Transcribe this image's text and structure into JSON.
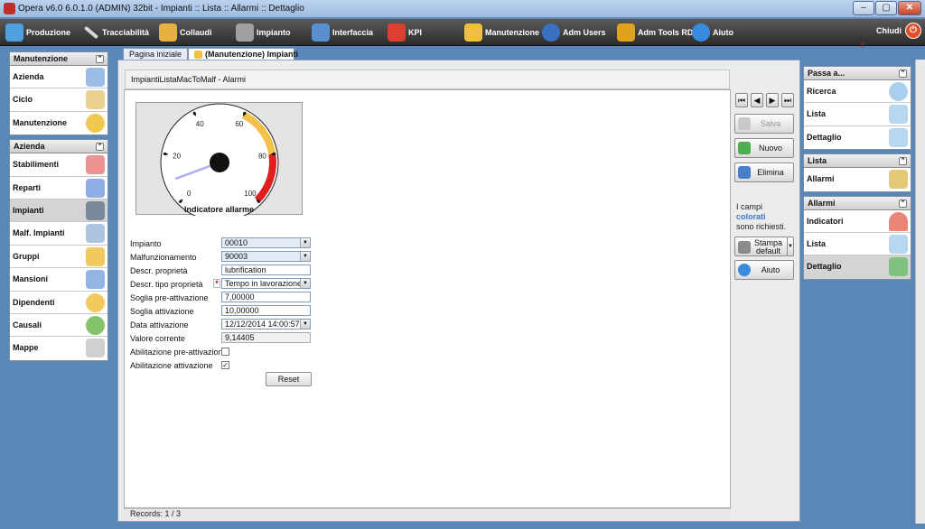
{
  "window": {
    "title": "Opera v6.0 6.0.1.0 (ADMIN) 32bit - Impianti :: Lista :: Allarmi :: Dettaglio",
    "controls": {
      "minimize": "–",
      "restore": "▢",
      "close": "✕"
    }
  },
  "toolbar": {
    "items": [
      {
        "label": "Produzione",
        "icon": "gears-icon",
        "color": "#4fa0e0"
      },
      {
        "label": "Tracciabilità",
        "icon": "wrench-icon",
        "color": "#d8d8d8"
      },
      {
        "label": "Collaudi",
        "icon": "checklist-icon",
        "color": "#e8b040"
      },
      {
        "label": "Impianto",
        "icon": "machine-icon",
        "color": "#a0a0a0"
      },
      {
        "label": "Interfaccia",
        "icon": "cable-icon",
        "color": "#5a8fd0"
      },
      {
        "label": "KPI",
        "icon": "kpi-chart-icon",
        "color": "#d84030"
      },
      {
        "label": "Manutenzione",
        "icon": "tools-icon",
        "color": "#f0c040"
      },
      {
        "label": "Adm Users",
        "icon": "user-icon",
        "color": "#3a70c0"
      },
      {
        "label": "Adm Tools RDP",
        "icon": "screwdriver-icon",
        "color": "#e0a020"
      },
      {
        "label": "Aiuto",
        "icon": "help-icon",
        "color": "#3a8ae0"
      }
    ],
    "close_label": "Chiudi",
    "close_icon": "power-icon"
  },
  "tabs": [
    {
      "label": "Pagina iniziale"
    },
    {
      "label": "(Manutenzione) Impianti",
      "active": true
    }
  ],
  "left_panel": {
    "groups": [
      {
        "title": "Manutenzione",
        "items": [
          {
            "label": "Azienda",
            "icon": "building-icon",
            "color": "#8ab0e0"
          },
          {
            "label": "Ciclo",
            "icon": "pencil-paper-icon",
            "color": "#e8c880"
          },
          {
            "label": "Manutenzione",
            "icon": "gear-icon",
            "color": "#f0c030"
          }
        ]
      },
      {
        "title": "Azienda",
        "items": [
          {
            "label": "Stabilimenti",
            "icon": "factory-icon",
            "color": "#e88080"
          },
          {
            "label": "Reparti",
            "icon": "building-icon",
            "color": "#7aa0e0"
          },
          {
            "label": "Impianti",
            "icon": "machine-icon",
            "color": "#6a7a90",
            "selected": true
          },
          {
            "label": "Malf. Impianti",
            "icon": "malfunction-icon",
            "color": "#a0b8d8"
          },
          {
            "label": "Gruppi",
            "icon": "group-icon",
            "color": "#f0c040"
          },
          {
            "label": "Mansioni",
            "icon": "task-icon",
            "color": "#80a8e0"
          },
          {
            "label": "Dipendenti",
            "icon": "person-icon",
            "color": "#f0c040"
          },
          {
            "label": "Causali",
            "icon": "question-icon",
            "color": "#70b850"
          },
          {
            "label": "Mappe",
            "icon": "map-icon",
            "color": "#c8c8c8"
          }
        ]
      }
    ]
  },
  "form": {
    "title": "ImpiantiListaMacToMalf - Alarmi",
    "gauge": {
      "label": "Indicatore allarme",
      "min": 0,
      "max": 100,
      "ticks": [
        "0",
        "20",
        "40",
        "60",
        "80",
        "100"
      ],
      "value": 9.14405,
      "warning_from": 60,
      "warning_to": 80,
      "alarm_from": 80,
      "alarm_to": 100,
      "warning_color": "#f2c14a",
      "alarm_color": "#e01e1e",
      "needle_color": "#aab0ee"
    },
    "fields": [
      {
        "label": "Impianto",
        "value": "00010",
        "type": "select",
        "required": true
      },
      {
        "label": "Malfunzionamento",
        "value": "90003",
        "type": "select",
        "required": true
      },
      {
        "label": "Descr. proprietà",
        "value": "lubrification",
        "type": "text"
      },
      {
        "label": "Descr. tipo proprietà",
        "value": "Tempo in lavorazione",
        "type": "select"
      },
      {
        "label": "Soglia pre-attivazione",
        "value": "7,00000",
        "type": "text"
      },
      {
        "label": "Soglia attivazione",
        "value": "10,00000",
        "type": "text"
      },
      {
        "label": "Data attivazione",
        "value": "12/12/2014 14:00:57",
        "type": "select"
      },
      {
        "label": "Valore corrente",
        "value": "9,14405",
        "type": "readonly"
      },
      {
        "label": "Abilitazione pre-attivazione",
        "checked": false,
        "type": "checkbox"
      },
      {
        "label": "Abilitazione attivazione",
        "checked": true,
        "type": "checkbox"
      }
    ],
    "required_mark": "*",
    "reset_label": "Reset",
    "status": "Records: 1 / 3"
  },
  "actions": {
    "nav": [
      "⏮",
      "◀",
      "▶",
      "⏭"
    ],
    "save_label": "Salva",
    "new_label": "Nuovo",
    "delete_label": "Elimina",
    "required_note_prefix": "I campi",
    "required_note_colored": "colorati",
    "required_note_suffix": "sono richiesti.",
    "print_label_1": "Stampa",
    "print_label_2": "default",
    "help_label": "Aiuto"
  },
  "right_panel": {
    "groups": [
      {
        "title": "Passa a...",
        "items": [
          {
            "label": "Ricerca",
            "icon": "magnifier-icon",
            "color": "#9ac8ec"
          },
          {
            "label": "Lista",
            "icon": "folder-icon",
            "color": "#a8d0f0"
          },
          {
            "label": "Dettaglio",
            "icon": "folder-add-icon",
            "color": "#a8d0f0"
          }
        ]
      },
      {
        "title": "Lista",
        "items": [
          {
            "label": "Allarmi",
            "icon": "alarm-list-icon",
            "color": "#e0c060"
          }
        ]
      },
      {
        "title": "Allarmi",
        "items": [
          {
            "label": "Indicatori",
            "icon": "gauge-icon",
            "color": "#e87060"
          },
          {
            "label": "Lista",
            "icon": "folder-icon",
            "color": "#a8d0f0"
          },
          {
            "label": "Dettaglio",
            "icon": "folder-add-icon",
            "color": "#70c070",
            "selected": true
          }
        ]
      }
    ]
  }
}
